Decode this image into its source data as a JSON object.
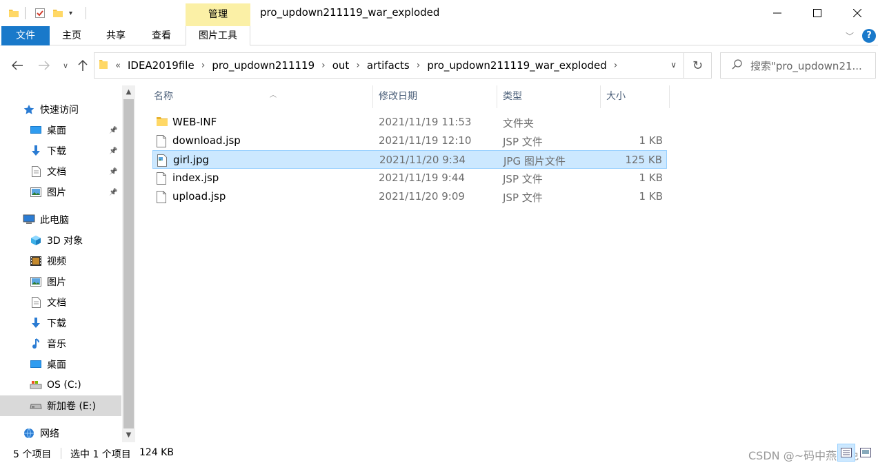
{
  "window": {
    "title": "pro_updown211119_war_exploded",
    "context_tab": "管理"
  },
  "ribbon": {
    "tabs": [
      {
        "label": "文件"
      },
      {
        "label": "主页"
      },
      {
        "label": "共享"
      },
      {
        "label": "查看"
      },
      {
        "label": "图片工具"
      }
    ],
    "help": "?"
  },
  "address": {
    "overflow": "«",
    "crumbs": [
      "IDEA2019file",
      "out",
      "artifacts",
      "pro_updown211119_war_exploded"
    ],
    "crumb_parent": "pro_updown211119"
  },
  "search": {
    "placeholder": "搜索\"pro_updown21..."
  },
  "sidebar": {
    "items": [
      {
        "label": "快速访问",
        "icon": "star-icon",
        "level": 0,
        "pinned": false
      },
      {
        "label": "桌面",
        "icon": "desktop-icon",
        "level": 1,
        "pinned": true
      },
      {
        "label": "下载",
        "icon": "download-icon",
        "level": 1,
        "pinned": true
      },
      {
        "label": "文档",
        "icon": "document-icon",
        "level": 1,
        "pinned": true
      },
      {
        "label": "图片",
        "icon": "picture-icon",
        "level": 1,
        "pinned": true
      },
      {
        "label": "此电脑",
        "icon": "computer-icon",
        "level": 0,
        "pinned": false
      },
      {
        "label": "3D 对象",
        "icon": "cube-icon",
        "level": 1,
        "pinned": false
      },
      {
        "label": "视频",
        "icon": "video-icon",
        "level": 1,
        "pinned": false
      },
      {
        "label": "图片",
        "icon": "picture-icon",
        "level": 1,
        "pinned": false
      },
      {
        "label": "文档",
        "icon": "document-icon",
        "level": 1,
        "pinned": false
      },
      {
        "label": "下载",
        "icon": "download-icon",
        "level": 1,
        "pinned": false
      },
      {
        "label": "音乐",
        "icon": "music-icon",
        "level": 1,
        "pinned": false
      },
      {
        "label": "桌面",
        "icon": "desktop-icon",
        "level": 1,
        "pinned": false
      },
      {
        "label": "OS (C:)",
        "icon": "drive-c-icon",
        "level": 1,
        "pinned": false
      },
      {
        "label": "新加卷 (E:)",
        "icon": "drive-icon",
        "level": 1,
        "pinned": false,
        "selected": true
      },
      {
        "label": "网络",
        "icon": "network-icon",
        "level": 0,
        "pinned": false
      }
    ]
  },
  "columns": {
    "name": "名称",
    "date": "修改日期",
    "type": "类型",
    "size": "大小"
  },
  "files": [
    {
      "name": "WEB-INF",
      "date": "2021/11/19 11:53",
      "type": "文件夹",
      "size": "",
      "icon": "folder-icon"
    },
    {
      "name": "download.jsp",
      "date": "2021/11/19 12:10",
      "type": "JSP 文件",
      "size": "1 KB",
      "icon": "file-icon"
    },
    {
      "name": "girl.jpg",
      "date": "2021/11/20 9:34",
      "type": "JPG 图片文件",
      "size": "125 KB",
      "icon": "image-file-icon",
      "selected": true
    },
    {
      "name": "index.jsp",
      "date": "2021/11/19 9:44",
      "type": "JSP 文件",
      "size": "1 KB",
      "icon": "file-icon"
    },
    {
      "name": "upload.jsp",
      "date": "2021/11/20 9:09",
      "type": "JSP 文件",
      "size": "1 KB",
      "icon": "file-icon"
    }
  ],
  "status": {
    "count": "5 个项目",
    "selected": "选中 1 个项目",
    "size": "124 KB",
    "watermark": "CSDN @~码中燕燕免"
  },
  "colors": {
    "accent": "#1979ca",
    "context_tab": "#fbf0a6",
    "selection": "#cce8ff",
    "selection_border": "#99d1ff"
  }
}
